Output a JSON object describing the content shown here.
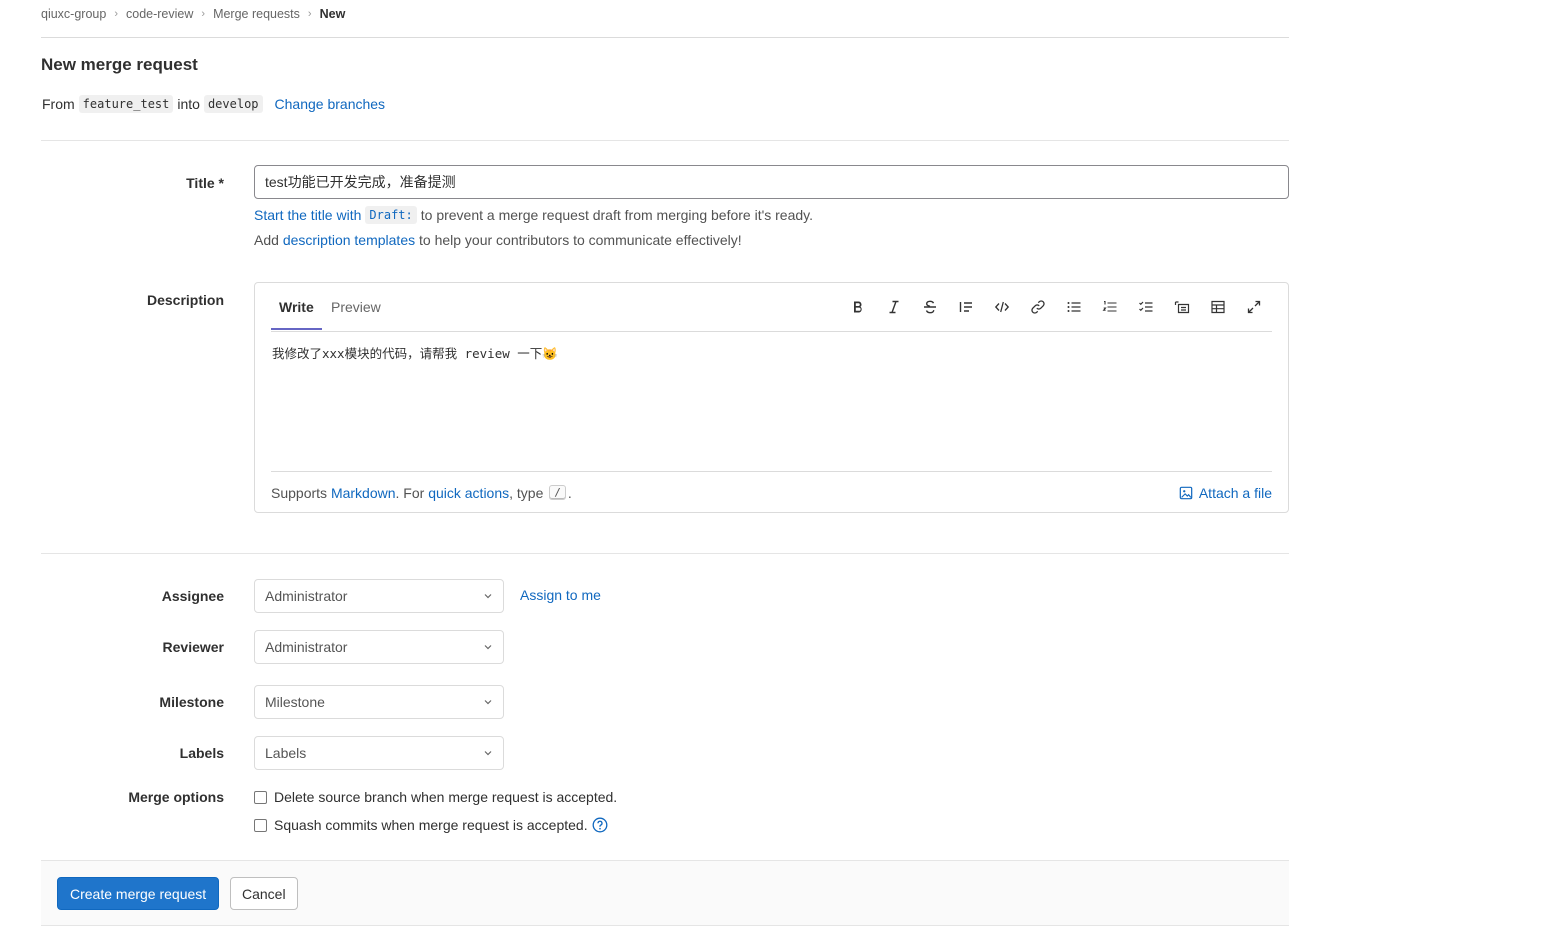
{
  "breadcrumbs": [
    {
      "label": "qiuxc-group"
    },
    {
      "label": "code-review"
    },
    {
      "label": "Merge requests"
    },
    {
      "label": "New"
    }
  ],
  "page": {
    "title": "New merge request",
    "from_label": "From",
    "source_branch": "feature_test",
    "into_label": "into",
    "target_branch": "develop",
    "change_branches": "Change branches"
  },
  "title_field": {
    "label": "Title *",
    "value": "test功能已开发完成，准备提测",
    "hint_link": "Start the title with",
    "hint_code": "Draft:",
    "hint_rest": "to prevent a merge request draft from merging before it's ready.",
    "templates_prefix": "Add",
    "templates_link": "description templates",
    "templates_suffix": "to help your contributors to communicate effectively!"
  },
  "description": {
    "label": "Description",
    "tab_write": "Write",
    "tab_preview": "Preview",
    "value": "我修改了xxx模块的代码，请帮我 review 一下😺",
    "footer_supports": "Supports",
    "footer_markdown": "Markdown",
    "footer_for": ". For",
    "footer_quick_actions": "quick actions",
    "footer_type": ", type",
    "footer_slash": "/",
    "footer_dot": ".",
    "attach": "Attach a file",
    "toolbar_icons": [
      "bold-icon",
      "italic-icon",
      "strikethrough-icon",
      "quote-icon",
      "code-icon",
      "link-icon",
      "bullet-list-icon",
      "numbered-list-icon",
      "task-list-icon",
      "collapsible-icon",
      "table-icon",
      "fullscreen-icon"
    ]
  },
  "assignee": {
    "label": "Assignee",
    "value": "Administrator",
    "assign_me": "Assign to me"
  },
  "reviewer": {
    "label": "Reviewer",
    "value": "Administrator"
  },
  "milestone": {
    "label": "Milestone",
    "value": "Milestone"
  },
  "labels": {
    "label": "Labels",
    "value": "Labels"
  },
  "merge_options": {
    "label": "Merge options",
    "delete_source": "Delete source branch when merge request is accepted.",
    "squash": "Squash commits when merge request is accepted."
  },
  "actions": {
    "create": "Create merge request",
    "cancel": "Cancel"
  },
  "colors": {
    "link": "#1068bf",
    "primary": "#1f75cb",
    "tab_underline": "#6666c4"
  }
}
